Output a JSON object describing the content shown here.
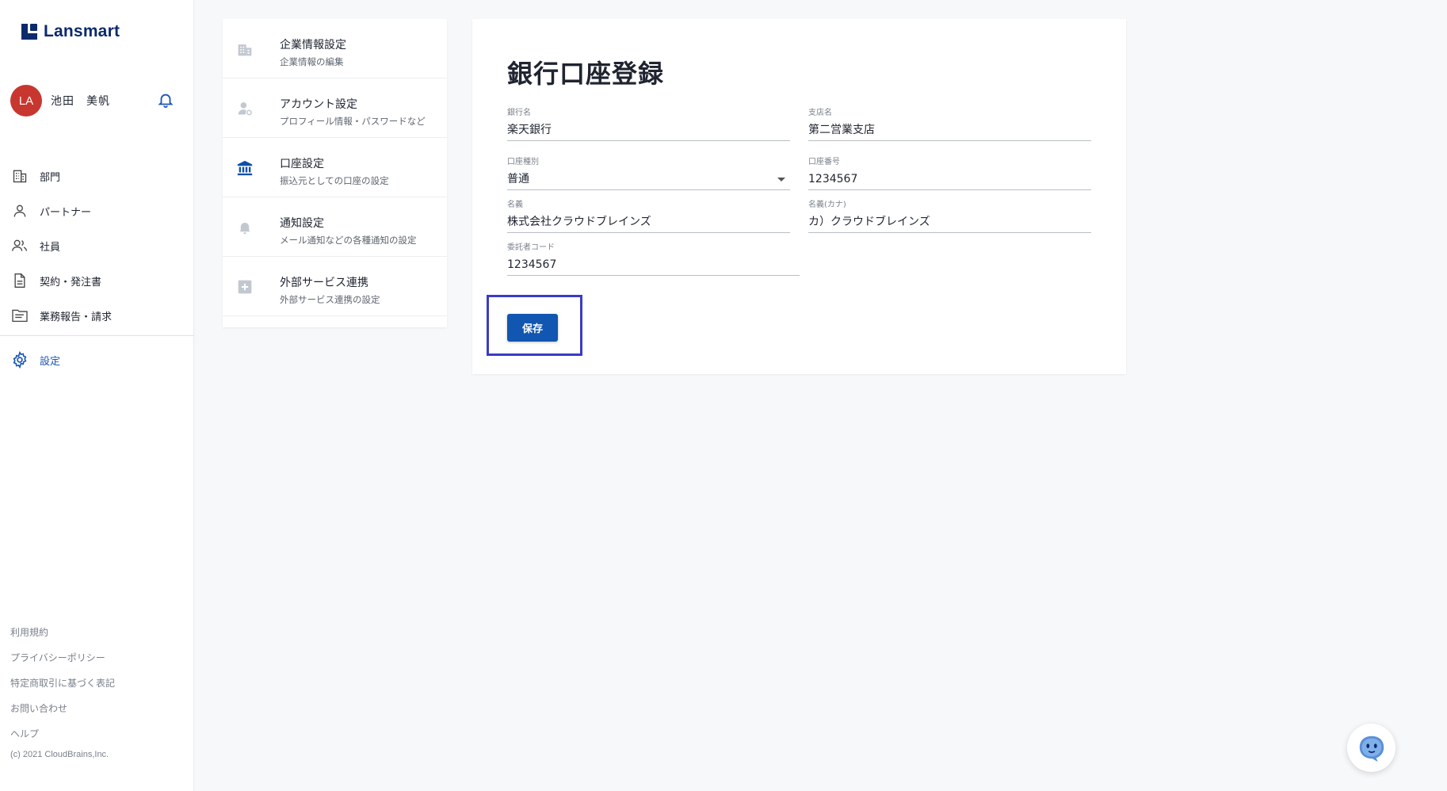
{
  "brand": {
    "name": "Lansmart",
    "color": "#0b2a6b"
  },
  "user": {
    "initials": "LA",
    "name": "池田　美帆"
  },
  "nav": {
    "items": [
      {
        "label": "部門",
        "icon": "building-icon"
      },
      {
        "label": "パートナー",
        "icon": "person-icon"
      },
      {
        "label": "社員",
        "icon": "people-icon"
      },
      {
        "label": "契約・発注書",
        "icon": "document-icon"
      },
      {
        "label": "業務報告・請求",
        "icon": "report-icon"
      }
    ],
    "settings": {
      "label": "設定",
      "icon": "gear-icon"
    }
  },
  "footer": {
    "links": [
      "利用規約",
      "プライバシーポリシー",
      "特定商取引に基づく表記",
      "お問い合わせ",
      "ヘルプ"
    ],
    "copyright": "(c) 2021 CloudBrains,Inc."
  },
  "settings_menu": [
    {
      "title": "企業情報設定",
      "subtitle": "企業情報の編集",
      "icon": "building-icon"
    },
    {
      "title": "アカウント設定",
      "subtitle": "プロフィール情報・パスワードなど",
      "icon": "account-settings-icon"
    },
    {
      "title": "口座設定",
      "subtitle": "振込元としての口座の設定",
      "icon": "bank-icon",
      "active": true
    },
    {
      "title": "通知設定",
      "subtitle": "メール通知などの各種通知の設定",
      "icon": "bell-icon"
    },
    {
      "title": "外部サービス連携",
      "subtitle": "外部サービス連携の設定",
      "icon": "plus-box-icon"
    }
  ],
  "form": {
    "title": "銀行口座登録",
    "fields": {
      "bank_name": {
        "label": "銀行名",
        "value": "楽天銀行"
      },
      "branch_name": {
        "label": "支店名",
        "value": "第二営業支店"
      },
      "account_type": {
        "label": "口座種別",
        "value": "普通"
      },
      "account_number": {
        "label": "口座番号",
        "value": "1234567"
      },
      "holder_name": {
        "label": "名義",
        "value": "株式会社クラウドブレインズ"
      },
      "holder_kana": {
        "label": "名義(カナ)",
        "value": "カ）クラウドブレインズ"
      },
      "consignor_code": {
        "label": "委託者コード",
        "value": "1234567"
      }
    },
    "save_label": "保存"
  },
  "colors": {
    "accent": "#1156b0",
    "highlight": "#3b3bc7",
    "avatar": "#c8372f"
  }
}
